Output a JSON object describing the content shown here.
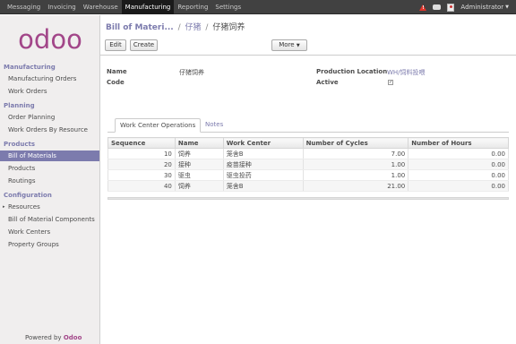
{
  "topbar": {
    "menu": [
      "Messaging",
      "Invoicing",
      "Warehouse",
      "Manufacturing",
      "Reporting",
      "Settings"
    ],
    "active_menu": "Manufacturing",
    "user": "Administrator"
  },
  "sidebar": {
    "logo": "odoo",
    "sections": [
      {
        "title": "Manufacturing",
        "items": [
          "Manufacturing Orders",
          "Work Orders"
        ]
      },
      {
        "title": "Planning",
        "items": [
          "Order Planning",
          "Work Orders By Resource"
        ]
      },
      {
        "title": "Products",
        "items": [
          "Bill of Materials",
          "Products",
          "Routings"
        ]
      },
      {
        "title": "Configuration",
        "items": [
          "Resources",
          "Bill of Material Components",
          "Work Centers",
          "Property Groups"
        ]
      }
    ],
    "active_item": "Bill of Materials",
    "powered_prefix": "Powered by",
    "powered_brand": "Odoo"
  },
  "breadcrumb": {
    "root": "Bill of Materi...",
    "parent": "仔猪",
    "current": "仔猪饲养"
  },
  "buttons": {
    "edit": "Edit",
    "create": "Create",
    "more": "More"
  },
  "form": {
    "name_label": "Name",
    "name_value": "仔猪饲养",
    "code_label": "Code",
    "code_value": "",
    "location_label": "Production Location",
    "location_value": "WH/饲料投喂",
    "active_label": "Active",
    "active_checked": true
  },
  "tabs": [
    "Work Center Operations",
    "Notes"
  ],
  "table": {
    "headers": [
      "Sequence",
      "Name",
      "Work Center",
      "Number of Cycles",
      "Number of Hours"
    ],
    "rows": [
      [
        "10",
        "饲养",
        "笼舍B",
        "7.00",
        "0.00"
      ],
      [
        "20",
        "接种",
        "疫苗接种",
        "1.00",
        "0.00"
      ],
      [
        "30",
        "驱虫",
        "驱虫投药",
        "1.00",
        "0.00"
      ],
      [
        "40",
        "饲养",
        "笼舍B",
        "21.00",
        "0.00"
      ]
    ]
  }
}
